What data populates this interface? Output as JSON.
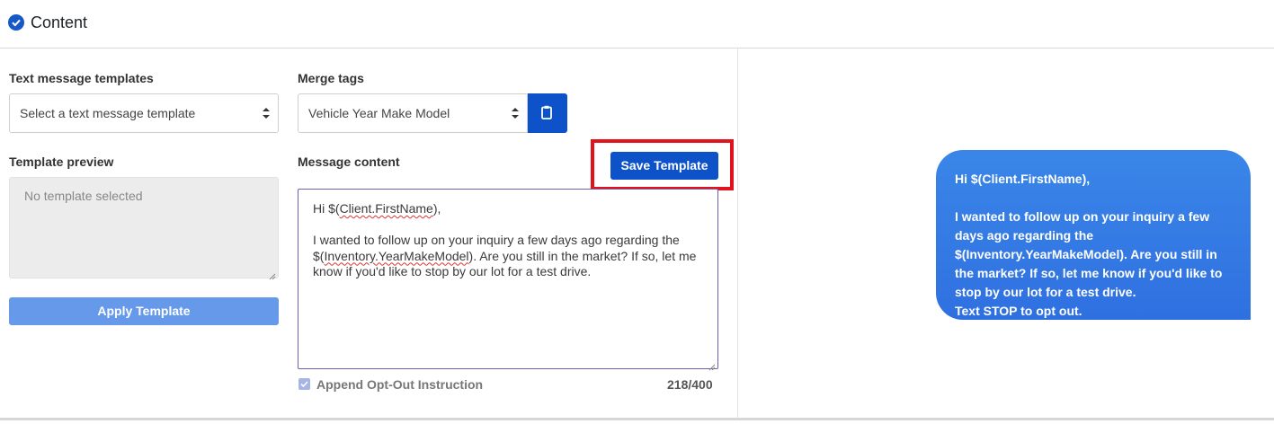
{
  "header": {
    "title": "Content"
  },
  "templates": {
    "label": "Text message templates",
    "select_value": "Select a text message template"
  },
  "merge": {
    "label": "Merge tags",
    "select_value": "Vehicle Year Make Model"
  },
  "preview": {
    "label": "Template preview",
    "placeholder": "No template selected",
    "apply_label": "Apply Template"
  },
  "message": {
    "label": "Message content",
    "save_label": "Save Template",
    "line1_prefix": "Hi $(",
    "line1_tag": "Client.FirstName",
    "line1_suffix": "),",
    "para2_prefix": "I wanted to follow up on your inquiry a few days ago regarding the $(",
    "para2_tag": "Inventory.YearMakeModel",
    "para2_suffix": "). Are you still in the market? If so, let me know if you'd like to stop by our lot for a test drive.",
    "optout_label": "Append Opt-Out Instruction",
    "optout_checked": true,
    "char_count": "218/400"
  },
  "phone_preview": {
    "text": "Hi $(Client.FirstName),\n\nI wanted to follow up on your inquiry a few days ago regarding the $(Inventory.YearMakeModel). Are you still in the market? If so, let me know if you'd like to stop by our lot for a test drive.\nText STOP to opt out."
  },
  "colors": {
    "primary": "#0d52c9",
    "apply_disabled": "#6699ea",
    "highlight": "#e0141e",
    "bubble": "#3a86e8"
  },
  "icons": [
    "check-circle-icon",
    "select-arrows-icon",
    "clipboard-icon",
    "checkbox-check-icon",
    "resize-grip-icon"
  ]
}
